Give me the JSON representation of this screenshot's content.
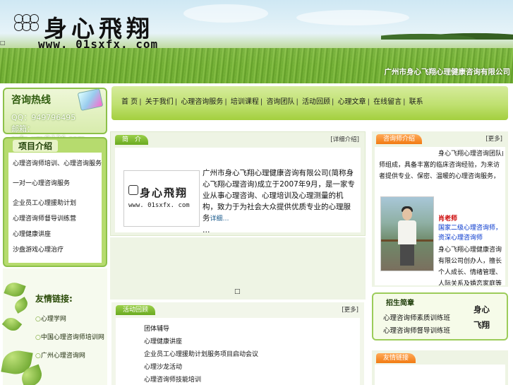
{
  "header": {
    "site_title": "身心飛翔",
    "url": "www. 01sxfx. com",
    "company": "广州市身心飞翔心理健康咨询有限公司",
    "corner_mark": "□"
  },
  "hotline": {
    "title": "咨询热线",
    "qq": "QQ：949796495",
    "email": "邮箱：sxfx_xm@126.com"
  },
  "projects": {
    "title": "项目介绍",
    "items": [
      "心理咨询师培训、心理咨询服务",
      "一对一心理咨询服务",
      "企业员工心理援助计划",
      "心理咨询师督导训练营",
      "心理健康讲座",
      "沙盘游戏心理治疗"
    ]
  },
  "links": {
    "title": "友情链接:",
    "items": [
      "心理学网",
      "中国心理咨询师培训网",
      "广州心理咨询网"
    ],
    "bullet": "○"
  },
  "nav": {
    "items": [
      "首 页",
      "关于我们",
      "心理咨询服务",
      "培训课程",
      "咨询团队",
      "活动回顾",
      "心理文章",
      "在线留言",
      "联系"
    ],
    "separator": "|"
  },
  "intro": {
    "tab": "简　介",
    "more": "[详细介绍]",
    "logo_title": "身心飛翔",
    "logo_url": "www. 01sxfx. com",
    "text": "广州市身心飞翔心理健康咨询有限公司(简称身心飞翔心理咨询)成立于2007年9月，是一家专业从事心理咨询、心理培训及心理测量的机构，致力于为社会大众提供优质专业的心理服务",
    "read_more": "详细…",
    "ellipsis": "…"
  },
  "center_mark": "□",
  "activities": {
    "tab": "活动回顾",
    "more": "[更多]",
    "items": [
      "团体辅导",
      "心理健康讲座",
      "企业员工心理援助计划服务项目启动会议",
      "心理沙龙活动",
      "心理咨询师技能培训"
    ]
  },
  "counselor": {
    "tab": "咨询师介绍",
    "more": "[更多]",
    "intro_lines": [
      "身心飞翔心理咨询团队由资深心理咨询",
      "师组成，具备丰富的临床咨询经验，为来访者提供专业、保密、温暖的心理咨询服务，帮助来访者走出困境"
    ],
    "name": "肖老师",
    "title": "国家二级心理咨询师，资深心理咨询师",
    "desc": "身心飞翔心理健康咨询有限公司创办人，擅长个人成长、情绪管理、人际关系及婚恋家庭等心理问题的咨询与辅导"
  },
  "recruit": {
    "title": "招生简章",
    "items": [
      "心理咨询师素质训练班",
      "心理咨询师督导训练班"
    ],
    "side_top": "身心",
    "side_bottom": "飞翔"
  },
  "friends": {
    "tab": "友情链接"
  },
  "colors": {
    "nav_green": "#bfe070",
    "tab_green": "#6aaa20",
    "tab_orange": "#f27a12",
    "border_green": "#8dc14a",
    "link_blue": "#0033cc",
    "name_red": "#cc0000"
  }
}
